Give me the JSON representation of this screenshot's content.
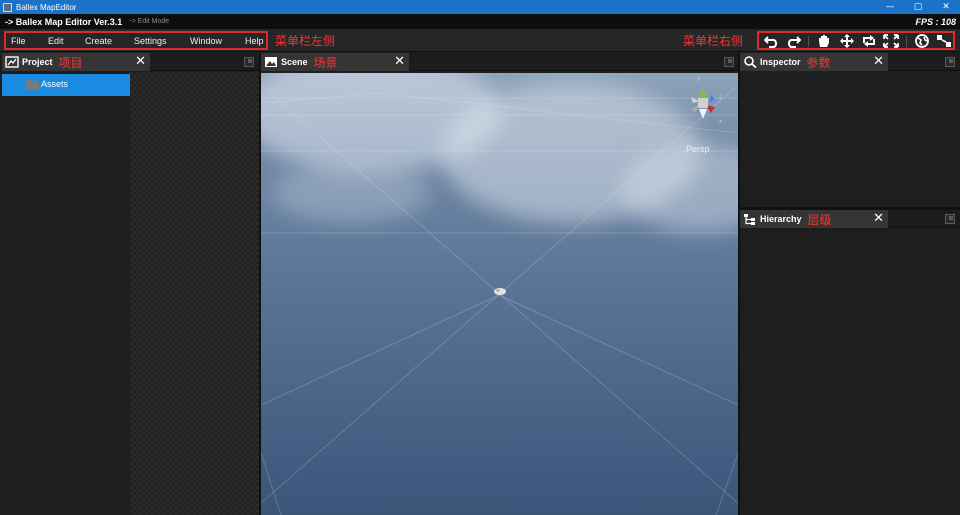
{
  "window": {
    "title": "Ballex MapEditor",
    "controls": {
      "minimize": "—",
      "maximize": "▢",
      "close": "✕"
    }
  },
  "status_bar": {
    "version": "-> Ballex Map Editor Ver.3.1",
    "mode": "-> Edit Mode",
    "fps": "FPS : 108"
  },
  "menubar": {
    "items": [
      "File",
      "Edit",
      "Create",
      "Settings",
      "Window",
      "Help"
    ],
    "left_annotation": "菜单栏左侧",
    "right_annotation": "菜单栏右侧",
    "toolbar": [
      "undo-icon",
      "redo-icon",
      "hand-icon",
      "move-icon",
      "rotate-icon",
      "scale-icon",
      "globe-icon",
      "snap-icon"
    ]
  },
  "panels": {
    "project": {
      "title": "Project",
      "annotation": "项目",
      "close": "✕",
      "tree": [
        {
          "label": "Assets",
          "selected": true
        }
      ]
    },
    "scene": {
      "title": "Scene",
      "annotation": "场景",
      "close": "✕",
      "camera_label": "Persp",
      "gizmo_axes": {
        "y": "y",
        "z": "z",
        "x": "x"
      }
    },
    "inspector": {
      "title": "Inspector",
      "annotation": "参数",
      "close": "✕"
    },
    "hierarchy": {
      "title": "Hierarchy",
      "annotation": "层级",
      "close": "✕"
    }
  },
  "colors": {
    "titlebar": "#1b73c9",
    "annotation_red": "#ff3333",
    "selection_blue": "#1a8be0",
    "panel_bg": "#1e1e1e"
  }
}
